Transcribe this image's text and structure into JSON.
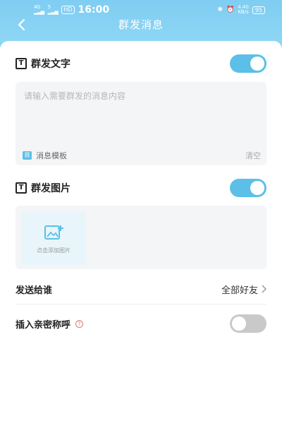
{
  "status_bar": {
    "network_left": "4G",
    "network_right": "5",
    "hd": "HD",
    "time": "16:00",
    "speed": "4.40\nKB/s",
    "battery": "95"
  },
  "header": {
    "title": "群发消息",
    "back_icon": "chevron-left-icon"
  },
  "text_section": {
    "label": "群发文字",
    "icon": "t-icon",
    "toggle_on": true,
    "placeholder": "请输入需要群发的消息内容",
    "template_label": "消息模板",
    "template_icon_text": "目",
    "clear_label": "清空"
  },
  "image_section": {
    "label": "群发图片",
    "icon": "t-icon",
    "toggle_on": true,
    "add_label": "点击添加图片",
    "add_icon": "image-add-icon"
  },
  "send_to": {
    "label": "发送给谁",
    "value": "全部好友"
  },
  "nickname": {
    "label": "插入亲密称呼",
    "help": "?",
    "toggle_on": false
  },
  "colors": {
    "accent": "#5cbfe8",
    "header": "#8ed6f5"
  }
}
